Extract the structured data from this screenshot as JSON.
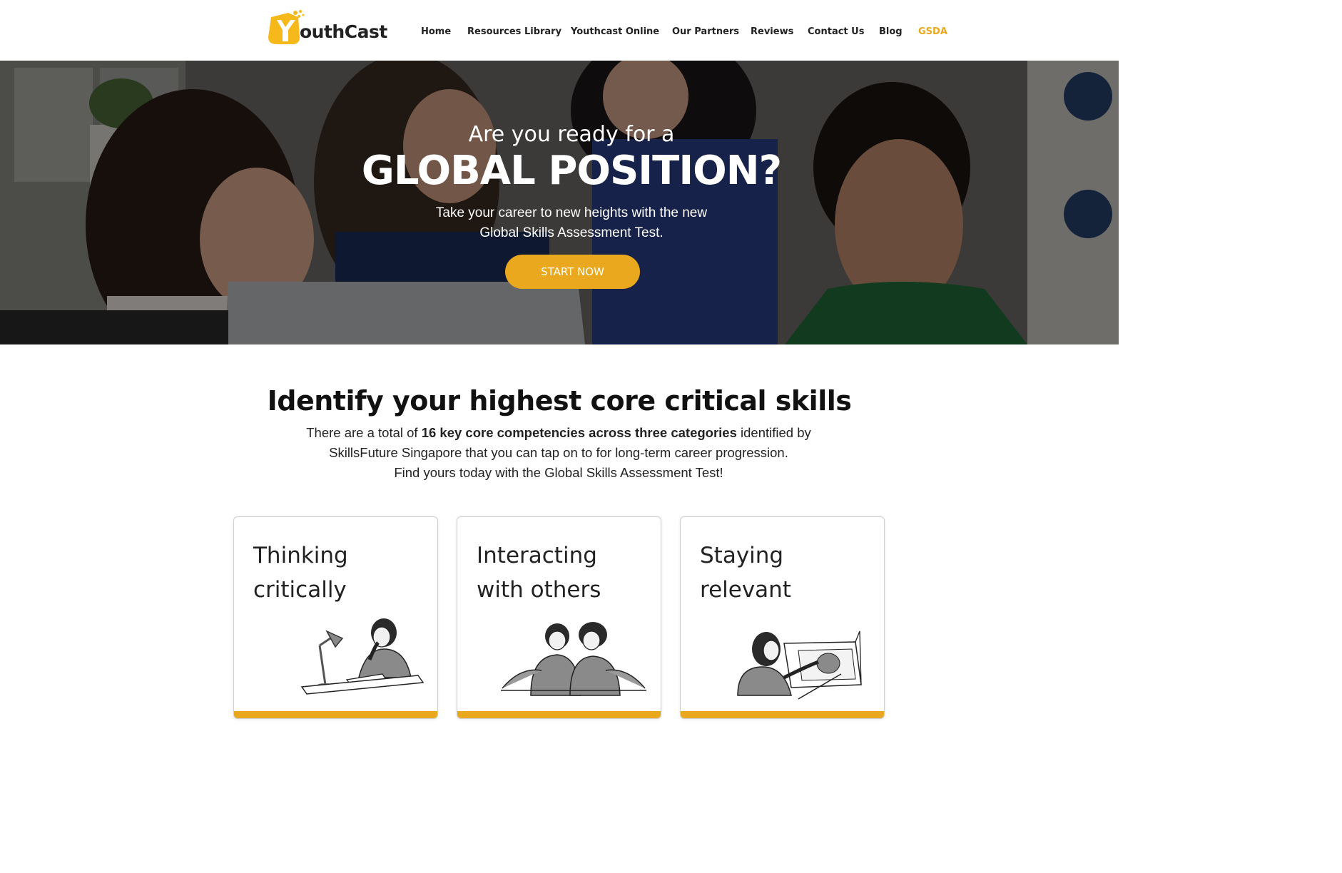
{
  "brand": {
    "logo_text": "outhCast",
    "accent_color": "#E9A81D"
  },
  "nav": {
    "items": [
      {
        "label": "Home"
      },
      {
        "label": "Resources Library"
      },
      {
        "label": "Youthcast Online"
      },
      {
        "label": "Our Partners"
      },
      {
        "label": "Reviews"
      },
      {
        "label": "Contact Us"
      },
      {
        "label": "Blog"
      },
      {
        "label": "GSDA",
        "active": true
      }
    ]
  },
  "hero": {
    "subtitle": "Are you ready for a",
    "title": "GLOBAL POSITION?",
    "desc_line1": "Take your career to new heights with the new",
    "desc_line2": "Global Skills Assessment Test.",
    "cta": "START NOW"
  },
  "skills": {
    "heading": "Identify your highest core critical skills",
    "text_pre": "There are a total of ",
    "text_bold1": "16 key core competencies across three categories",
    "text_mid": " identified by",
    "text_line2": "SkillsFuture Singapore that you can tap on to for long-term career progression.",
    "text_line3": "Find yours today with the Global Skills Assessment Test!",
    "cards": [
      {
        "line1": "Thinking",
        "line2": "critically",
        "icon": "person-at-desk-with-lamp-illustration"
      },
      {
        "line1": "Interacting",
        "line2": "with others",
        "icon": "two-friends-illustration"
      },
      {
        "line1": "Staying",
        "line2": "relevant",
        "icon": "person-drawing-on-tablet-illustration"
      }
    ]
  }
}
